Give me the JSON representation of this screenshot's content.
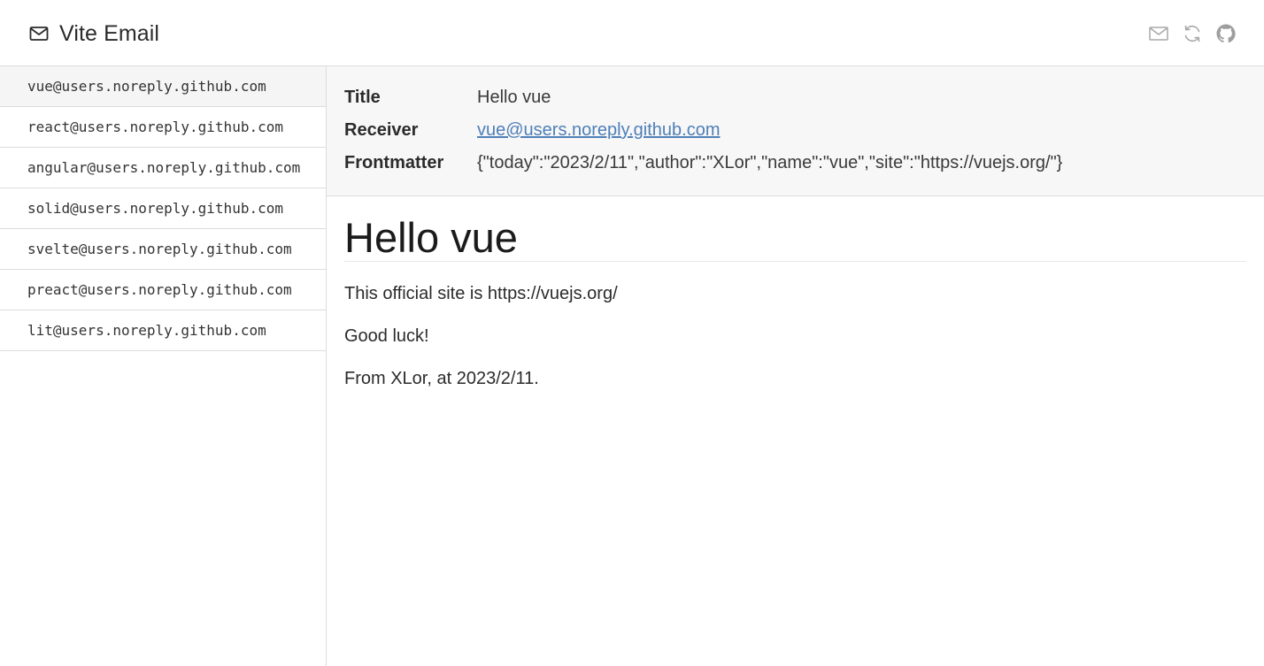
{
  "header": {
    "title": "Vite Email",
    "icons": [
      "mail-icon",
      "send-mail-icon",
      "refresh-icon",
      "github-icon"
    ]
  },
  "sidebar": {
    "items": [
      {
        "label": "vue@users.noreply.github.com",
        "active": true
      },
      {
        "label": "react@users.noreply.github.com",
        "active": false
      },
      {
        "label": "angular@users.noreply.github.com",
        "active": false
      },
      {
        "label": "solid@users.noreply.github.com",
        "active": false
      },
      {
        "label": "svelte@users.noreply.github.com",
        "active": false
      },
      {
        "label": "preact@users.noreply.github.com",
        "active": false
      },
      {
        "label": "lit@users.noreply.github.com",
        "active": false
      }
    ]
  },
  "meta": {
    "title_label": "Title",
    "title_value": "Hello vue",
    "receiver_label": "Receiver",
    "receiver_value": "vue@users.noreply.github.com",
    "frontmatter_label": "Frontmatter",
    "frontmatter_value": "{\"today\":\"2023/2/11\",\"author\":\"XLor\",\"name\":\"vue\",\"site\":\"https://vuejs.org/\"}"
  },
  "email": {
    "heading": "Hello vue",
    "paragraphs": [
      "This official site is https://vuejs.org/",
      "Good luck!",
      "From XLor, at 2023/2/11."
    ]
  },
  "colors": {
    "link": "#4f7fb8",
    "active_item_bg": "#f5f5f5",
    "meta_bg": "#f7f7f7",
    "border": "#dcdcdc",
    "icon_gray": "#9e9e9e"
  }
}
